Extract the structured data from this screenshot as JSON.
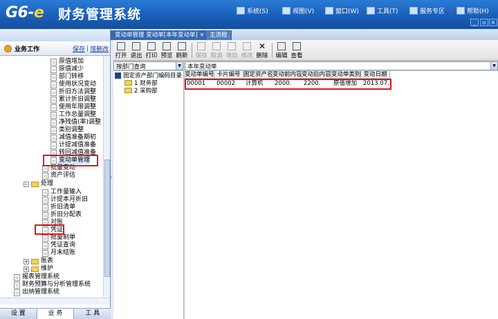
{
  "app": {
    "logo_main": "G6-",
    "logo_e": "e",
    "title": "财务管理系统"
  },
  "top_menu": [
    {
      "label": "系统(S)",
      "icon": "system-icon"
    },
    {
      "label": "视图(V)",
      "icon": "view-icon"
    },
    {
      "label": "窗口(W)",
      "icon": "window-icon"
    },
    {
      "label": "工具(T)",
      "icon": "tools-icon"
    },
    {
      "label": "服务专区",
      "icon": "service-icon"
    },
    {
      "label": "帮助(H)",
      "icon": "help-icon"
    }
  ],
  "workspace": {
    "title": "业务工作",
    "save_link": "保存",
    "sep": "|",
    "add_link": "增删改"
  },
  "tree": {
    "items": [
      {
        "label": "原值增加",
        "kind": "doc"
      },
      {
        "label": "原值减少",
        "kind": "doc"
      },
      {
        "label": "部门转移",
        "kind": "doc"
      },
      {
        "label": "使用状况变动",
        "kind": "doc"
      },
      {
        "label": "折旧方法调整",
        "kind": "doc"
      },
      {
        "label": "累计折旧调整",
        "kind": "doc"
      },
      {
        "label": "使用年限调整",
        "kind": "doc"
      },
      {
        "label": "工作总量调整",
        "kind": "doc"
      },
      {
        "label": "净残值(率)调整",
        "kind": "doc"
      },
      {
        "label": "类别调整",
        "kind": "doc"
      },
      {
        "label": "减值准备期初",
        "kind": "doc"
      },
      {
        "label": "计提减值准备",
        "kind": "doc"
      },
      {
        "label": "转回减值准备",
        "kind": "doc"
      },
      {
        "label": "变动单管理",
        "kind": "doc"
      },
      {
        "label": "批量变动",
        "kind": "doc"
      },
      {
        "label": "资产评估",
        "kind": "doc"
      },
      {
        "label": "处理",
        "kind": "folder"
      },
      {
        "label": "工作量输入",
        "kind": "doc"
      },
      {
        "label": "计提本月折旧",
        "kind": "doc"
      },
      {
        "label": "折旧清单",
        "kind": "doc"
      },
      {
        "label": "折旧分配表",
        "kind": "doc"
      },
      {
        "label": "对账",
        "kind": "doc"
      },
      {
        "label": "凭证",
        "kind": "doc"
      },
      {
        "label": "批量制单",
        "kind": "doc"
      },
      {
        "label": "凭证查询",
        "kind": "doc"
      },
      {
        "label": "月末结账",
        "kind": "doc"
      },
      {
        "label": "账表",
        "kind": "folder"
      },
      {
        "label": "维护",
        "kind": "folder"
      },
      {
        "label": "报表管理系统",
        "kind": "doc"
      },
      {
        "label": "财务预算与分析管理系统",
        "kind": "doc"
      },
      {
        "label": "出纳管理系统",
        "kind": "doc"
      }
    ]
  },
  "left_tabs": [
    "设 置",
    "业 务",
    "工 具"
  ],
  "doc_tabs": [
    {
      "label": "变动单管理 变动单[本年变动单]",
      "close": "×"
    },
    {
      "label": "主流程"
    }
  ],
  "toolbar": [
    {
      "label": "打开",
      "icon": "open-icon",
      "enabled": true
    },
    {
      "label": "退出",
      "icon": "exit-icon",
      "enabled": true
    },
    {
      "label": "打印",
      "icon": "print-icon",
      "enabled": true
    },
    {
      "label": "预览",
      "icon": "preview-icon",
      "enabled": true
    },
    {
      "label": "刷新",
      "icon": "refresh-icon",
      "enabled": true
    },
    {
      "label": "保存",
      "icon": "save-icon",
      "enabled": false
    },
    {
      "label": "取消",
      "icon": "cancel-icon",
      "enabled": false
    },
    {
      "label": "增加",
      "icon": "add-icon",
      "enabled": false
    },
    {
      "label": "修改",
      "icon": "edit-icon",
      "enabled": false
    },
    {
      "label": "删除",
      "icon": "delete-icon",
      "enabled": true
    },
    {
      "label": "编辑",
      "icon": "compose-icon",
      "enabled": true
    },
    {
      "label": "查看",
      "icon": "view-detail-icon",
      "enabled": true
    }
  ],
  "filters": {
    "query_mode": "按部门查询",
    "range": "本年变动单"
  },
  "dept_tree": {
    "root": "固定资产部门编码目录",
    "items": [
      "1 财务部",
      "2 采购部"
    ]
  },
  "grid": {
    "columns": [
      "变动单编号",
      "卡片编号",
      "固定资产名称",
      "变动前内容",
      "变动后内容",
      "变动单类别",
      "变动日期"
    ],
    "rows": [
      [
        "00001",
        "00002",
        "计算机",
        "2000.",
        "2200.",
        "原值增加",
        "2013.07.26"
      ]
    ]
  },
  "colors": {
    "titlebar": "#1a5fb8",
    "highlight": "#e0141e",
    "tab_active": "#3568b4"
  }
}
